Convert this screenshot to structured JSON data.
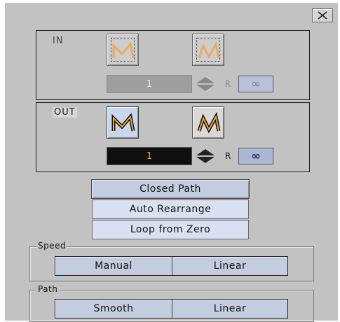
{
  "window": {
    "close_glyph": "✕"
  },
  "in_group": {
    "label": "IN",
    "value": "1",
    "r_label": "R",
    "infinity": "∞"
  },
  "out_group": {
    "label": "OUT",
    "value": "1",
    "r_label": "R",
    "infinity": "∞"
  },
  "buttons": {
    "closed_path": "Closed Path",
    "auto_rearrange": "Auto Rearrange",
    "loop_from_zero": "Loop from Zero"
  },
  "speed": {
    "label": "Speed",
    "options": [
      "Manual",
      "Linear"
    ]
  },
  "path": {
    "label": "Path",
    "options": [
      "Smooth",
      "Linear"
    ]
  },
  "colors": {
    "panel": "#c2c2c2",
    "accent": "#f2a63a",
    "selected": "#c8d6ee"
  }
}
